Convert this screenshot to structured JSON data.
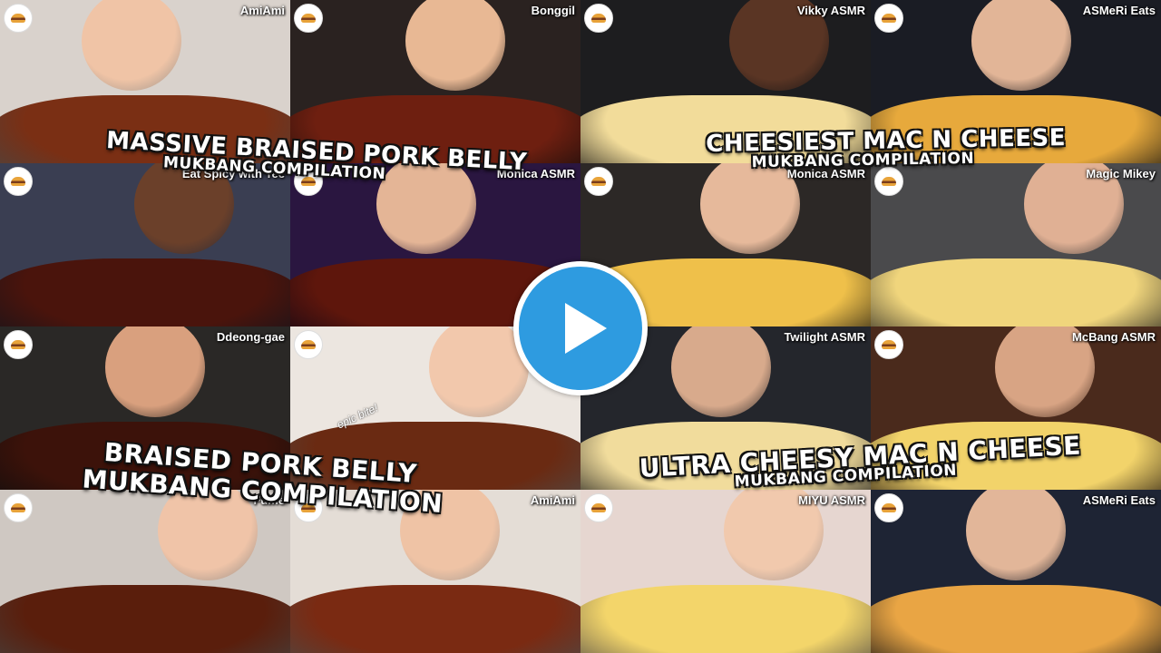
{
  "tiles": [
    {
      "channel": "AmiAmi",
      "bg": "#d9d2cc",
      "skin": "#f0c4a6",
      "food": "#7a2f14"
    },
    {
      "channel": "Bonggil",
      "bg": "#2a2220",
      "skin": "#e8b894",
      "food": "#6e1f10"
    },
    {
      "channel": "Vikky ASMR",
      "bg": "#1d1d1f",
      "skin": "#5a3524",
      "food": "#f2dc9a"
    },
    {
      "channel": "ASMeRi Eats",
      "bg": "#1a1c24",
      "skin": "#e2b597",
      "food": "#e7a93c"
    },
    {
      "channel": "Eat Spicy with Tee",
      "bg": "#3a3e52",
      "skin": "#6b402a",
      "food": "#4a140c"
    },
    {
      "channel": "Monica ASMR",
      "bg": "#2a1640",
      "skin": "#e4b596",
      "food": "#5e160c"
    },
    {
      "channel": "Monica ASMR",
      "bg": "#2c2826",
      "skin": "#e6b99b",
      "food": "#efc04a"
    },
    {
      "channel": "Magic Mikey",
      "bg": "#4a4a4c",
      "skin": "#e0b094",
      "food": "#f0d57c"
    },
    {
      "channel": "Ddeong-gae",
      "bg": "#2a2826",
      "skin": "#d9a07e",
      "food": "#3c120a"
    },
    {
      "channel": "",
      "bg": "#ece6e0",
      "skin": "#f2c8ac",
      "food": "#6a2a12"
    },
    {
      "channel": "Twilight ASMR",
      "bg": "#24262c",
      "skin": "#d8aa8c",
      "food": "#f1dc9c"
    },
    {
      "channel": "McBang ASMR",
      "bg": "#4a2a1c",
      "skin": "#d8a484",
      "food": "#f2d36a"
    },
    {
      "channel": "Fume",
      "bg": "#cfc8c2",
      "skin": "#f0c4a8",
      "food": "#5a1e0c"
    },
    {
      "channel": "AmiAmi",
      "bg": "#e4ddd6",
      "skin": "#efc3a5",
      "food": "#7a2a12"
    },
    {
      "channel": "MIYU ASMR",
      "bg": "#e6d6d0",
      "skin": "#f1c9ad",
      "food": "#f3d56a"
    },
    {
      "channel": "ASMeRi Eats",
      "bg": "#1e2434",
      "skin": "#e2b699",
      "food": "#e9a544"
    }
  ],
  "titles": {
    "t1_main": "MASSIVE BRAISED PORK BELLY",
    "t1_sub": "MUKBANG COMPILATION",
    "t2_main": "CHEESIEST MAC N CHEESE",
    "t2_sub": "MUKBANG COMPILATION",
    "t3_main": "BRAISED PORK BELLY",
    "t3_sub": "MUKBANG COMPILATION",
    "t4_main": "ULTRA CHEESY MAC N CHEESE",
    "t4_sub": "MUKBANG COMPILATION"
  },
  "epic_bite": "epic bite!",
  "play_button": {
    "icon": "play-icon",
    "color": "#2e9be0"
  }
}
